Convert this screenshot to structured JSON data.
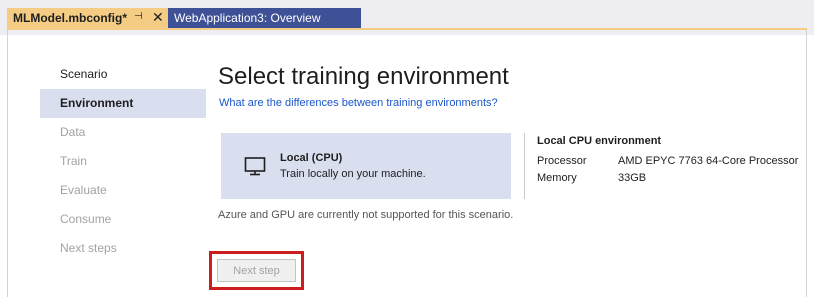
{
  "tabs": [
    {
      "label": "MLModel.mbconfig*",
      "active": true
    },
    {
      "label": "WebApplication3: Overview",
      "active": false
    }
  ],
  "nav": {
    "items": [
      {
        "label": "Scenario",
        "state": "normal"
      },
      {
        "label": "Environment",
        "state": "active"
      },
      {
        "label": "Data",
        "state": "disabled"
      },
      {
        "label": "Train",
        "state": "disabled"
      },
      {
        "label": "Evaluate",
        "state": "disabled"
      },
      {
        "label": "Consume",
        "state": "disabled"
      },
      {
        "label": "Next steps",
        "state": "disabled"
      }
    ]
  },
  "main": {
    "title": "Select training environment",
    "link": "What are the differences between training environments?",
    "option": {
      "title": "Local (CPU)",
      "description": "Train locally on your machine.",
      "icon": "monitor-icon"
    },
    "details": {
      "title": "Local CPU environment",
      "rows": [
        {
          "key": "Processor",
          "value": "AMD EPYC 7763 64-Core Processor"
        },
        {
          "key": "Memory",
          "value": "33GB"
        }
      ]
    },
    "note": "Azure and GPU are currently not supported for this scenario.",
    "next_button": "Next step"
  },
  "colors": {
    "active_tab": "#f5cc84",
    "inactive_tab": "#3f5196",
    "selected_bg": "#dadff0",
    "link": "#1a56c8",
    "highlight": "#cc1e1e"
  }
}
